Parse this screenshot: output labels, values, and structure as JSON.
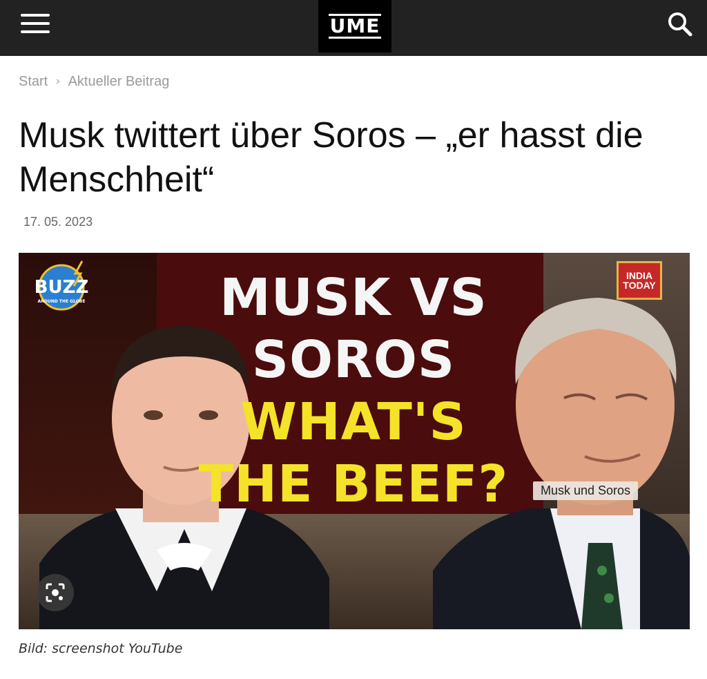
{
  "header": {
    "menu_icon": "hamburger-icon",
    "logo_text": "UME",
    "search_icon": "search-icon",
    "background": "#222222"
  },
  "breadcrumb": {
    "items": [
      "Start",
      "Aktueller Beitrag"
    ],
    "separator": "›"
  },
  "article": {
    "title": "Musk twittert über Soros – „er hasst die Menschheit“",
    "date": "17. 05. 2023",
    "image": {
      "headline_line1": "MUSK VS",
      "headline_line2": "SOROS",
      "headline_line3": "WHAT'S",
      "headline_line4": "THE BEEF?",
      "buzz_logo": "BUZZ",
      "buzz_logo_sub": "AROUND THE GLOBE",
      "channel_logo_line1": "INDIA",
      "channel_logo_line2": "TODAY",
      "caption_tag": "Musk und Soros",
      "lens_icon": "lens-icon",
      "headline_white": "#f5f5f5",
      "headline_yellow": "#f4e329"
    },
    "image_credit": "Bild: screenshot YouTube"
  }
}
